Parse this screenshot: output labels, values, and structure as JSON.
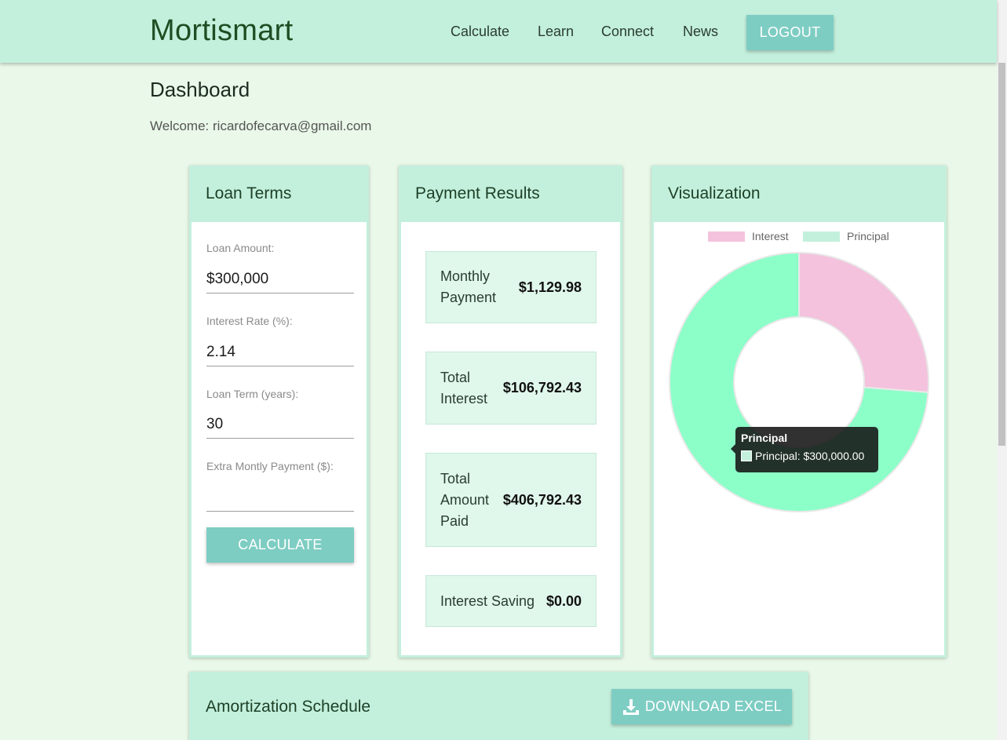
{
  "nav": {
    "brand": "Mortismart",
    "links": [
      "Calculate",
      "Learn",
      "Connect",
      "News"
    ],
    "logout_label": "LOGOUT"
  },
  "page": {
    "title": "Dashboard",
    "welcome_prefix": "Welcome:",
    "user_email": "ricardofecarva@gmail.com"
  },
  "loan_terms": {
    "title": "Loan Terms",
    "fields": [
      {
        "label": "Loan Amount:",
        "value": "$300,000"
      },
      {
        "label": "Interest Rate (%):",
        "value": "2.14"
      },
      {
        "label": "Loan Term (years):",
        "value": "30"
      },
      {
        "label": "Extra Montly Payment ($):",
        "value": ""
      }
    ],
    "calculate_label": "CALCULATE"
  },
  "payment_results": {
    "title": "Payment Results",
    "items": [
      {
        "label": "Monthly Payment",
        "value": "$1,129.98"
      },
      {
        "label": "Total Interest",
        "value": "$106,792.43"
      },
      {
        "label": "Total Amount Paid",
        "value": "$406,792.43"
      },
      {
        "label": "Interest Saving",
        "value": "$0.00"
      }
    ]
  },
  "visualization": {
    "title": "Visualization",
    "tooltip": {
      "title": "Principal",
      "line": "Principal: $300,000.00"
    }
  },
  "chart_data": {
    "type": "pie",
    "categories": [
      "Interest",
      "Principal"
    ],
    "values": [
      106792.43,
      300000.0
    ],
    "colors": [
      "#f4c2dc",
      "#8cffc8"
    ],
    "legend_colors": [
      "#f4c2dc",
      "#c3f0dc"
    ],
    "legend_position": "top"
  },
  "amortization": {
    "title": "Amortization Schedule",
    "download_label": "DOWNLOAD EXCEL"
  }
}
